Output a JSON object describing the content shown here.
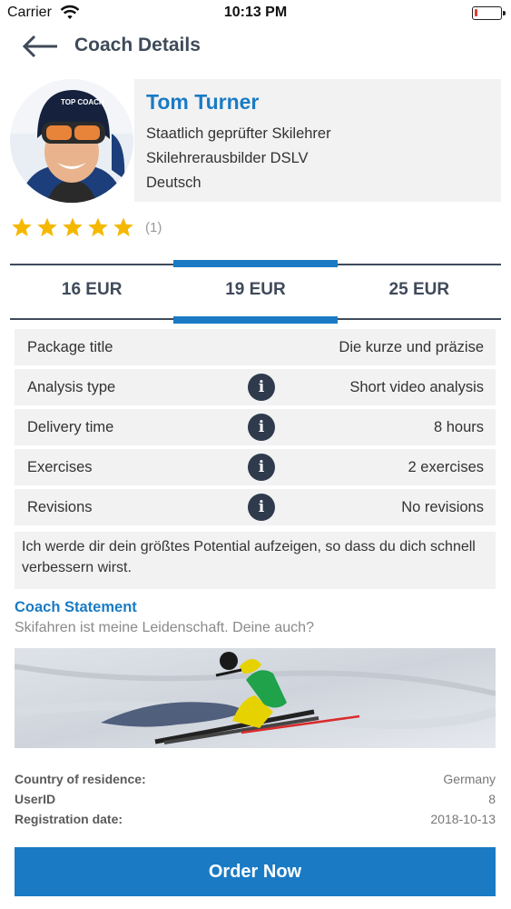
{
  "status_bar": {
    "carrier": "Carrier",
    "time": "10:13 PM",
    "battery_level": 0.1,
    "battery_color": "#e53935"
  },
  "header": {
    "back_icon": "arrow-left-icon",
    "title": "Coach Details"
  },
  "coach": {
    "name": "Tom Turner",
    "qualifications": [
      "Staatlich geprüfter Skilehrer",
      "Skilehrerausbilder DSLV",
      "Deutsch"
    ],
    "rating_stars": 5,
    "rating_count": "(1)",
    "star_color": "#f5b800"
  },
  "price_tabs": [
    {
      "label": "16 EUR",
      "active": false
    },
    {
      "label": "19 EUR",
      "active": true
    },
    {
      "label": "25 EUR",
      "active": false
    }
  ],
  "package": {
    "rows": [
      {
        "label": "Package title",
        "value": "Die kurze und präzise",
        "info": false
      },
      {
        "label": "Analysis type",
        "value": "Short video analysis",
        "info": true
      },
      {
        "label": "Delivery time",
        "value": "8 hours",
        "info": true
      },
      {
        "label": "Exercises",
        "value": "2 exercises",
        "info": true
      },
      {
        "label": "Revisions",
        "value": "No revisions",
        "info": true
      }
    ],
    "info_icon_glyph": "i",
    "description": "Ich werde dir dein größtes Potential aufzeigen, so dass du dich schnell verbessern wirst."
  },
  "statement": {
    "title": "Coach Statement",
    "text": "Skifahren ist meine Leidenschaft. Deine auch?"
  },
  "meta": {
    "country_label": "Country of residence:",
    "country_value": "Germany",
    "userid_label": "UserID",
    "userid_value": "8",
    "registration_label": "Registration date:",
    "registration_value": "2018-10-13"
  },
  "order_button": "Order Now",
  "colors": {
    "accent": "#1a7bc4",
    "dark": "#3f4a5a",
    "row_background": "#f2f2f3"
  }
}
